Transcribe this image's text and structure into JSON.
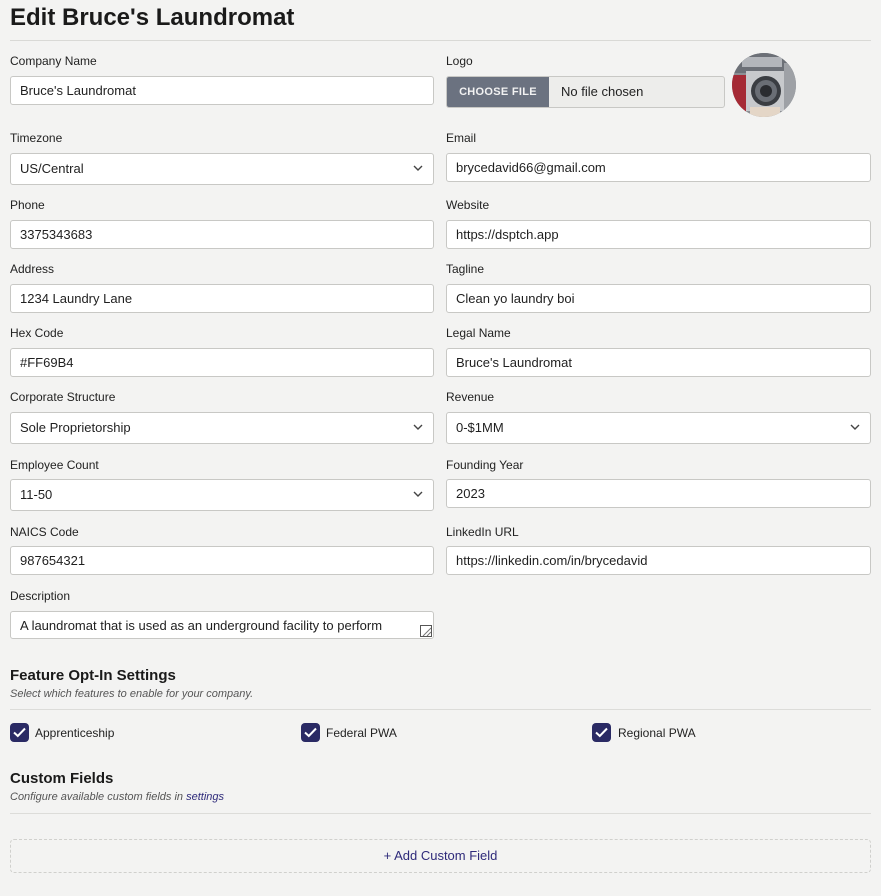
{
  "page": {
    "title": "Edit Bruce's Laundromat"
  },
  "form": {
    "company_name": {
      "label": "Company Name",
      "value": "Bruce's Laundromat"
    },
    "logo": {
      "label": "Logo",
      "button": "CHOOSE FILE",
      "status": "No file chosen"
    },
    "timezone": {
      "label": "Timezone",
      "value": "US/Central"
    },
    "email": {
      "label": "Email",
      "value": "brycedavid66@gmail.com"
    },
    "phone": {
      "label": "Phone",
      "value": "3375343683"
    },
    "website": {
      "label": "Website",
      "value": "https://dsptch.app"
    },
    "address": {
      "label": "Address",
      "value": "1234 Laundry Lane"
    },
    "tagline": {
      "label": "Tagline",
      "value": "Clean yo laundry boi"
    },
    "hex_code": {
      "label": "Hex Code",
      "value": "#FF69B4"
    },
    "legal_name": {
      "label": "Legal Name",
      "value": "Bruce's Laundromat"
    },
    "corporate_structure": {
      "label": "Corporate Structure",
      "value": "Sole Proprietorship"
    },
    "revenue": {
      "label": "Revenue",
      "value": "0-$1MM"
    },
    "employee_count": {
      "label": "Employee Count",
      "value": "11-50"
    },
    "founding_year": {
      "label": "Founding Year",
      "value": "2023"
    },
    "naics_code": {
      "label": "NAICS Code",
      "value": "987654321"
    },
    "linkedin_url": {
      "label": "LinkedIn URL",
      "value": "https://linkedin.com/in/brycedavid"
    },
    "description": {
      "label": "Description",
      "value": "A laundromat that is used as an underground facility to perform"
    }
  },
  "features": {
    "title": "Feature Opt-In Settings",
    "subtitle": "Select which features to enable for your company.",
    "items": [
      {
        "label": "Apprenticeship",
        "checked": true
      },
      {
        "label": "Federal PWA",
        "checked": true
      },
      {
        "label": "Regional PWA",
        "checked": true
      }
    ]
  },
  "custom_fields": {
    "title": "Custom Fields",
    "subtitle_prefix": "Configure available custom fields in",
    "settings_link": "settings",
    "add_button": "+ Add Custom Field"
  },
  "colors": {
    "accent": "#2a2a64",
    "link": "#2e2a7a",
    "file_button": "#6b7280"
  },
  "icons": {
    "select": "chevron-down-icon",
    "check": "checkmark-icon"
  }
}
